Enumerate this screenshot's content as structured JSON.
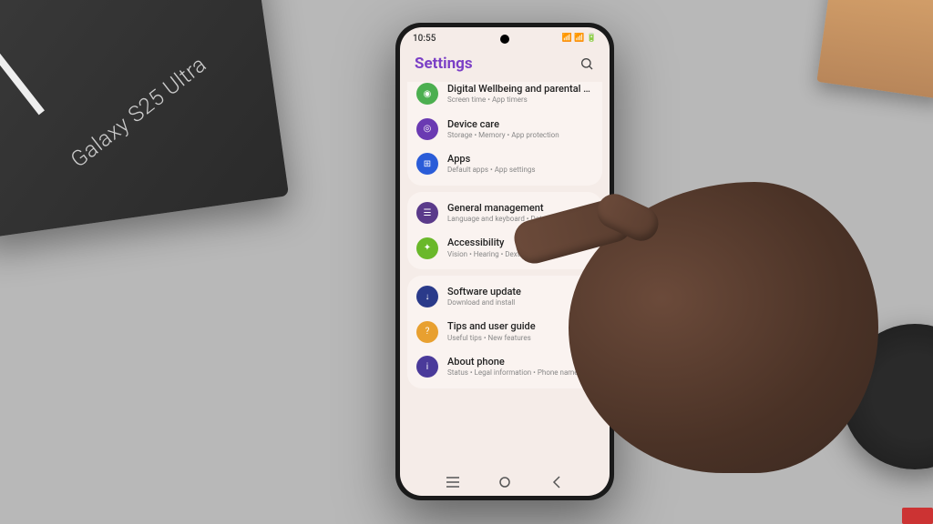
{
  "productBox": {
    "label": "Galaxy S25 Ultra"
  },
  "statusBar": {
    "time": "10:55",
    "indicators": "📶 📶 🔋"
  },
  "header": {
    "title": "Settings"
  },
  "groups": [
    {
      "clippedTop": true,
      "items": [
        {
          "icon": "ic-green",
          "glyph": "◉",
          "name": "digital-wellbeing",
          "title": "Digital Wellbeing and parental controls",
          "sub": "Screen time • App timers"
        },
        {
          "icon": "ic-purple",
          "glyph": "◎",
          "name": "device-care",
          "title": "Device care",
          "sub": "Storage • Memory • App protection"
        },
        {
          "icon": "ic-blue",
          "glyph": "⊞",
          "name": "apps",
          "title": "Apps",
          "sub": "Default apps • App settings"
        }
      ]
    },
    {
      "items": [
        {
          "icon": "ic-darkpurple",
          "glyph": "☰",
          "name": "general-management",
          "title": "General management",
          "sub": "Language and keyboard • Date and time"
        },
        {
          "icon": "ic-lime",
          "glyph": "✦",
          "name": "accessibility",
          "title": "Accessibility",
          "sub": "Vision • Hearing • Dexterity"
        }
      ]
    },
    {
      "items": [
        {
          "icon": "ic-navy",
          "glyph": "↓",
          "name": "software-update",
          "title": "Software update",
          "sub": "Download and install"
        },
        {
          "icon": "ic-orange",
          "glyph": "?",
          "name": "tips-guide",
          "title": "Tips and user guide",
          "sub": "Useful tips • New features"
        },
        {
          "icon": "ic-indigo",
          "glyph": "i",
          "name": "about-phone",
          "title": "About phone",
          "sub": "Status • Legal information • Phone name"
        }
      ]
    }
  ]
}
